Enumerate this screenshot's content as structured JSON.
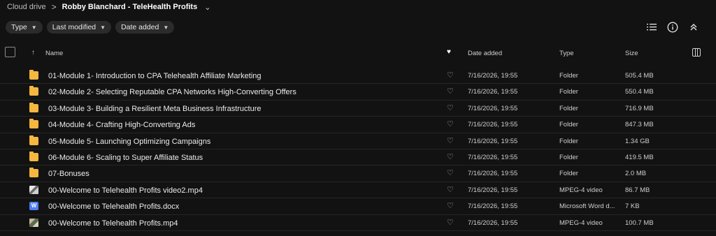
{
  "breadcrumb": {
    "root": "Cloud drive",
    "separator": ">",
    "current": "Robby Blanchard - TeleHealth Profits"
  },
  "filters": [
    {
      "label": "Type"
    },
    {
      "label": "Last modified"
    },
    {
      "label": "Date added"
    }
  ],
  "columns": {
    "name": "Name",
    "date_added": "Date added",
    "type": "Type",
    "size": "Size"
  },
  "rows": [
    {
      "icon": "folder-icon",
      "name": "01-Module 1- Introduction to CPA Telehealth Affiliate Marketing",
      "date": "7/16/2026, 19:55",
      "type": "Folder",
      "size": "505.4 MB"
    },
    {
      "icon": "folder-icon",
      "name": "02-Module 2- Selecting Reputable CPA Networks High-Converting Offers",
      "date": "7/16/2026, 19:55",
      "type": "Folder",
      "size": "550.4 MB"
    },
    {
      "icon": "folder-icon",
      "name": "03-Module 3- Building a Resilient Meta Business Infrastructure",
      "date": "7/16/2026, 19:55",
      "type": "Folder",
      "size": "716.9 MB"
    },
    {
      "icon": "folder-icon",
      "name": "04-Module 4- Crafting High-Converting Ads",
      "date": "7/16/2026, 19:55",
      "type": "Folder",
      "size": "847.3 MB"
    },
    {
      "icon": "folder-icon",
      "name": "05-Module 5- Launching Optimizing Campaigns",
      "date": "7/16/2026, 19:55",
      "type": "Folder",
      "size": "1.34 GB"
    },
    {
      "icon": "folder-icon",
      "name": "06-Module 6- Scaling to Super Affiliate Status",
      "date": "7/16/2026, 19:55",
      "type": "Folder",
      "size": "419.5 MB"
    },
    {
      "icon": "folder-icon",
      "name": "07-Bonuses",
      "date": "7/16/2026, 19:55",
      "type": "Folder",
      "size": "2.0 MB"
    },
    {
      "icon": "video-thumbnail-icon",
      "name": "00-Welcome to Telehealth Profits video2.mp4",
      "date": "7/16/2026, 19:55",
      "type": "MPEG-4 video",
      "size": "86.7 MB"
    },
    {
      "icon": "word-document-icon",
      "icon_letter": "W",
      "name": "00-Welcome to Telehealth Profits.docx",
      "date": "7/16/2026, 19:55",
      "type": "Microsoft Word d...",
      "size": "7 KB"
    },
    {
      "icon": "video-thumbnail-icon",
      "name": "00-Welcome to Telehealth Profits.mp4",
      "date": "7/16/2026, 19:55",
      "type": "MPEG-4 video",
      "size": "100.7 MB"
    }
  ],
  "colors": {
    "background": "#121212",
    "folder": "#f5b740",
    "word": "#4e7ff0",
    "chip": "#2b2b2b"
  }
}
